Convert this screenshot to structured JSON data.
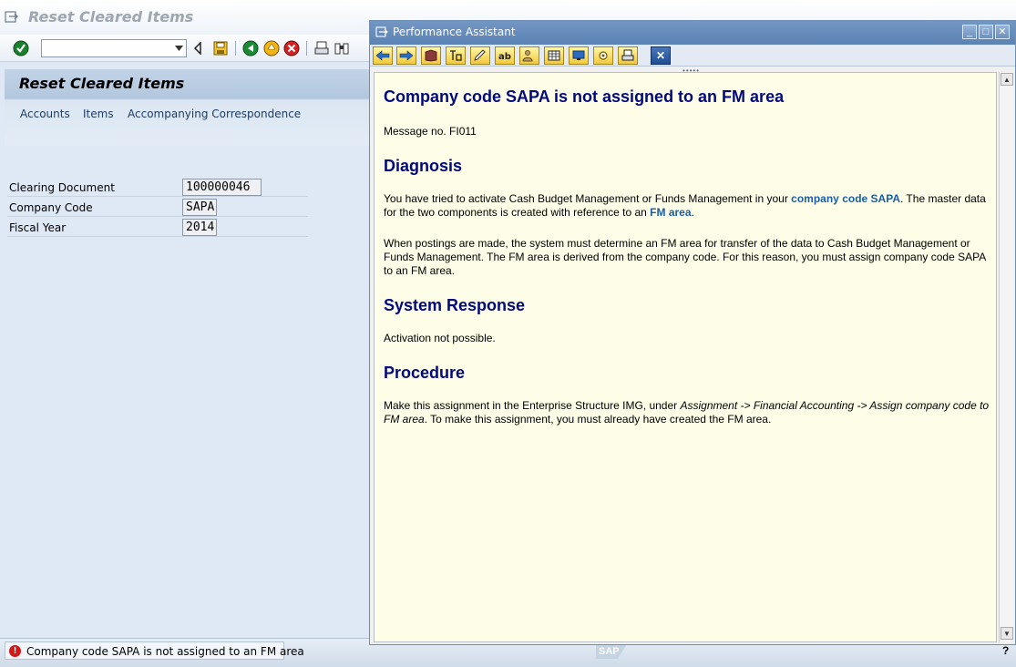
{
  "app": {
    "title": "Reset Cleared Items"
  },
  "toolbar": {
    "command_field_value": ""
  },
  "screen": {
    "header_title": "Reset Cleared Items",
    "tabs": [
      {
        "label": "Accounts"
      },
      {
        "label": "Items"
      },
      {
        "label": "Accompanying Correspondence"
      }
    ],
    "fields": [
      {
        "label": "Clearing Document",
        "value": "100000046"
      },
      {
        "label": "Company Code",
        "value": "SAPA"
      },
      {
        "label": "Fiscal Year",
        "value": "2014"
      }
    ]
  },
  "status": {
    "message": "Company code SAPA is not assigned to an FM area",
    "type_icon": "error-icon",
    "logo_text": "SAP"
  },
  "assistant": {
    "window_title": "Performance Assistant",
    "heading": "Company code SAPA is not assigned to an FM area",
    "message_no": "Message no. FI011",
    "diagnosis": {
      "heading": "Diagnosis",
      "p1_a": "You have tried to activate Cash Budget Management or Funds Management in your ",
      "p1_link1": "company code SAPA",
      "p1_b": ". The master data for the two components is created with reference to an ",
      "p1_link2": "FM area",
      "p1_c": ".",
      "p2": "When postings are made, the system must determine an FM area for transfer of the data to Cash Budget Management or Funds Management. The FM area is derived from the company code. For this reason, you must assign company code SAPA to an FM area."
    },
    "system_response": {
      "heading": "System Response",
      "text": "Activation not possible."
    },
    "procedure": {
      "heading": "Procedure",
      "text_a": "Make this assignment in the Enterprise Structure IMG, under ",
      "text_path": "Assignment -> Financial Accounting -> Assign company code to FM area",
      "text_b": ". To make this assignment, you must already have created the FM area."
    }
  },
  "colors": {
    "heading": "#00087e",
    "link": "#1a5ea8",
    "content_bg": "#fdfde8",
    "error": "#d41818"
  }
}
